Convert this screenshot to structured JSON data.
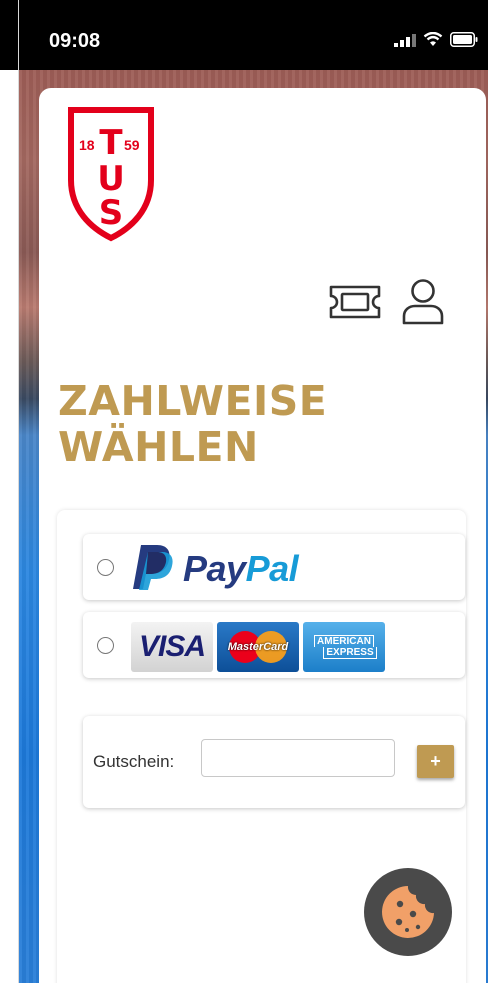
{
  "status_bar": {
    "time": "09:08"
  },
  "logo": {
    "year_left": "18",
    "year_right": "59",
    "letters": [
      "T",
      "U",
      "S"
    ]
  },
  "header": {
    "ticket_icon": "ticket-icon",
    "account_icon": "user-icon"
  },
  "page": {
    "title_line1": "ZAHLWEISE",
    "title_line2": "WÄHLEN"
  },
  "payment_methods": {
    "paypal": {
      "word_pay": "Pay",
      "word_pal": "Pal"
    },
    "cards": {
      "visa": "VISA",
      "mastercard": "MasterCard",
      "amex_line1": "AMERICAN",
      "amex_line2": "EXPRESS"
    }
  },
  "voucher": {
    "label": "Gutschein:",
    "value": "",
    "add_label": "+"
  },
  "colors": {
    "accent_gold": "#bf9a52",
    "logo_red": "#e3001b",
    "paypal_dark": "#253b80",
    "paypal_light": "#179bd7"
  },
  "cookie": {
    "icon": "cookie-icon"
  }
}
